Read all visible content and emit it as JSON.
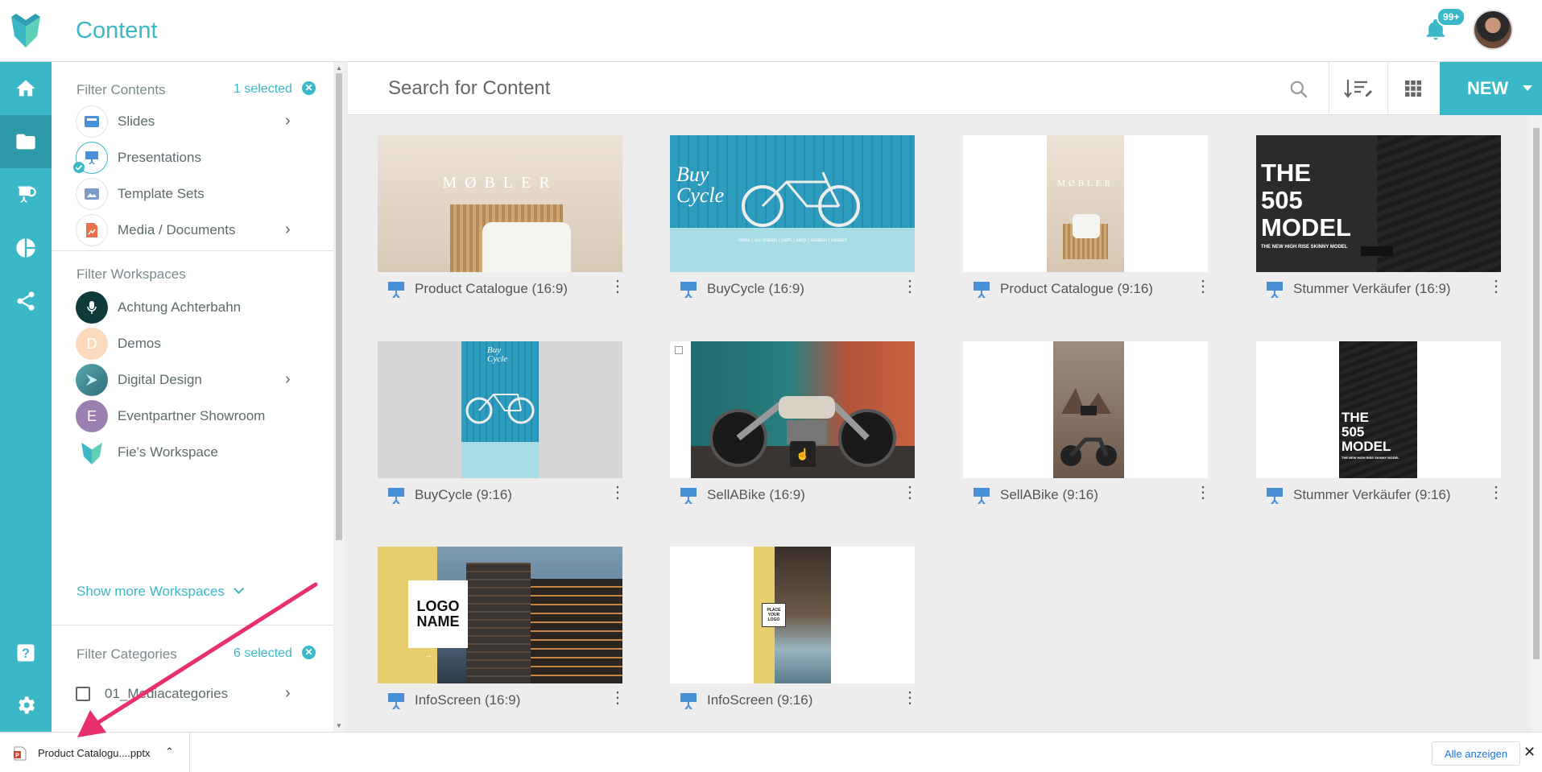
{
  "header": {
    "title": "Content",
    "notification_badge": "99+"
  },
  "filter": {
    "contents": {
      "title": "Filter Contents",
      "selected": "1 selected",
      "items": [
        {
          "label": "Slides",
          "has_submenu": true
        },
        {
          "label": "Presentations",
          "has_submenu": false,
          "checked": true
        },
        {
          "label": "Template Sets",
          "has_submenu": false
        },
        {
          "label": "Media / Documents",
          "has_submenu": true
        }
      ]
    },
    "workspaces": {
      "title": "Filter Workspaces",
      "items": [
        {
          "label": "Achtung Achterbahn",
          "initial": ""
        },
        {
          "label": "Demos",
          "initial": "D"
        },
        {
          "label": "Digital Design",
          "initial": "",
          "has_submenu": true
        },
        {
          "label": "Eventpartner Showroom",
          "initial": "E"
        },
        {
          "label": "Fie's Workspace",
          "initial": ""
        }
      ],
      "show_more": "Show more Workspaces"
    },
    "categories": {
      "title": "Filter Categories",
      "selected": "6 selected",
      "items": [
        {
          "label": "01_Mediacategories",
          "has_submenu": true
        }
      ]
    }
  },
  "search": {
    "placeholder": "Search for Content"
  },
  "toolbar": {
    "new_label": "NEW"
  },
  "cards": [
    {
      "title": "Product Catalogue (16:9)"
    },
    {
      "title": "BuyCycle (16:9)"
    },
    {
      "title": "Product Catalogue (9:16)"
    },
    {
      "title": "Stummer Verkäufer (16:9)"
    },
    {
      "title": "BuyCycle (9:16)"
    },
    {
      "title": "SellABike (16:9)"
    },
    {
      "title": "SellABike (9:16)"
    },
    {
      "title": "Stummer Verkäufer (9:16)"
    },
    {
      "title": "InfoScreen (16:9)"
    },
    {
      "title": "InfoScreen (9:16)"
    }
  ],
  "thumb_text": {
    "mobler": "MØBLER",
    "buycycle": "Buy Cycle",
    "buycycle_nav": "home | our brands | parts | story | location | contact",
    "model_line1": "THE",
    "model_line2": "505",
    "model_line3": "MODEL",
    "model_sub": "THE NEW HIGH RISE SKINNY MODEL",
    "logo_line1": "LOGO",
    "logo_line2": "NAME",
    "place_logo": "PLACE YOUR LOGO"
  },
  "download_bar": {
    "file_name": "Product Catalogu....pptx",
    "show_all": "Alle anzeigen"
  },
  "colors": {
    "accent": "#3bb8c7",
    "rail_active": "#2c9aa8",
    "arrow": "#e8306e"
  }
}
